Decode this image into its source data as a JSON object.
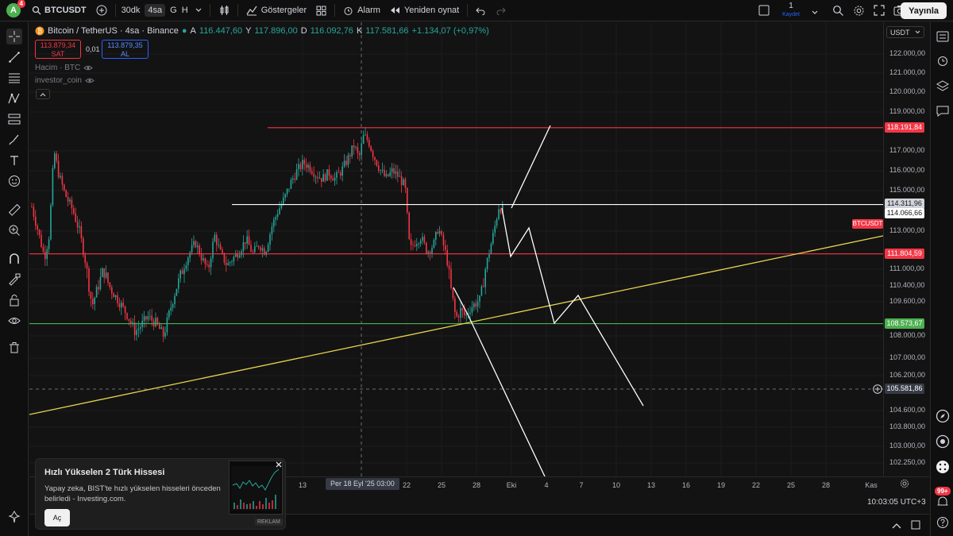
{
  "header": {
    "avatar_letter": "A",
    "avatar_badge": "4",
    "symbol": "BTCUSDT",
    "timeframes": [
      "30dk",
      "4sa",
      "G",
      "H"
    ],
    "indicators_label": "Göstergeler",
    "alarm_label": "Alarm",
    "replay_label": "Yeniden oynat",
    "save_count": "1",
    "save_label": "Kaydet",
    "publish_label": "Yayınla"
  },
  "legend": {
    "title": "Bitcoin / TetherUS · 4sa · Binance",
    "o_key": "A",
    "o_val": "116.447,60",
    "h_key": "Y",
    "h_val": "117.896,00",
    "l_key": "D",
    "l_val": "116.092,76",
    "c_key": "K",
    "c_val": "117.581,66",
    "change": "+1.134,07 (+0,97%)",
    "sell_price": "113.879,34",
    "sell_label": "SAT",
    "spread": "0,01",
    "buy_price": "113.879,35",
    "buy_label": "AL",
    "indicator_1": "Hacim · BTC",
    "indicator_2": "investor_coin"
  },
  "price_axis": {
    "currency": "USDT",
    "ticks": [
      {
        "label": "122.000,00",
        "value": 122000
      },
      {
        "label": "121.000,00",
        "value": 121000
      },
      {
        "label": "120.000,00",
        "value": 120000
      },
      {
        "label": "119.000,00",
        "value": 119000
      },
      {
        "label": "117.000,00",
        "value": 117000
      },
      {
        "label": "116.000,00",
        "value": 116000
      },
      {
        "label": "115.000,00",
        "value": 115000
      },
      {
        "label": "113.000,00",
        "value": 113000
      },
      {
        "label": "111.000,00",
        "value": 111000
      },
      {
        "label": "110.400,00",
        "value": 110400
      },
      {
        "label": "109.600,00",
        "value": 109600
      },
      {
        "label": "108.000,00",
        "value": 108000
      },
      {
        "label": "107.000,00",
        "value": 107000
      },
      {
        "label": "106.200,00",
        "value": 106200
      },
      {
        "label": "104.600,00",
        "value": 104600
      },
      {
        "label": "103.800,00",
        "value": 103800
      },
      {
        "label": "103.000,00",
        "value": 103000
      },
      {
        "label": "102.250,00",
        "value": 102250
      }
    ],
    "labels": [
      {
        "text": "118.191,84",
        "value": 118191.84,
        "bg": "#f23645",
        "fg": "#ffffff"
      },
      {
        "text": "114.311,96",
        "value": 114311.96,
        "bg": "#d1d4dc",
        "fg": "#131313"
      },
      {
        "text": "114.066,66",
        "value": 114066.66,
        "bg": "#ffffff",
        "fg": "#131313"
      },
      {
        "text": "111.804,59",
        "value": 111804.59,
        "bg": "#f23645",
        "fg": "#ffffff"
      },
      {
        "text": "108.573,67",
        "value": 108573.67,
        "bg": "#4caf50",
        "fg": "#ffffff"
      },
      {
        "text": "105.581,86",
        "value": 105581.86,
        "bg": "#363a45",
        "fg": "#ffffff"
      }
    ],
    "symbol_tag": "BTCUSDT"
  },
  "time_axis": {
    "ticks": [
      "13",
      "22",
      "25",
      "28",
      "Eki",
      "4",
      "7",
      "10",
      "13",
      "16",
      "19",
      "22",
      "25",
      "28",
      "Kas"
    ],
    "crosshair_label": "Per 18 Eyl '25   03:00",
    "clock": "10:03:05 UTC+3"
  },
  "levels": {
    "resistance": 118191.84,
    "white_level": 114311.96,
    "red_level": 111804.59,
    "support": 108573.67
  },
  "ad": {
    "title": "Hızlı Yükselen 2 Türk Hissesi",
    "text": "Yapay zeka, BIST'te hızlı yükselen hisseleri önceden belirledi - Investing.com.",
    "button": "Aç",
    "label": "REKLAM"
  },
  "colors": {
    "up": "#26a69a",
    "down": "#f23645",
    "accent": "#2962ff",
    "trendline": "#e8d44d"
  },
  "right_badge": "99+"
}
